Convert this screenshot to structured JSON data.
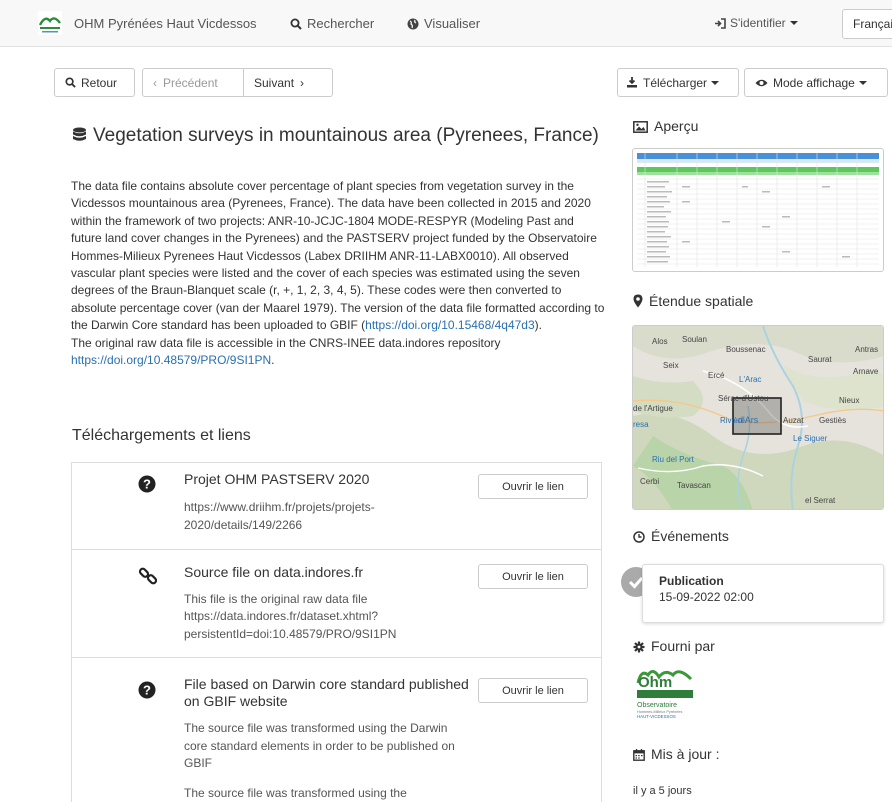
{
  "navbar": {
    "brand": "OHM Pyrénées Haut Vicdessos",
    "search": "Rechercher",
    "visualize": "Visualiser",
    "login": "S'identifier",
    "language": "Françai"
  },
  "toolbar": {
    "back": "Retour",
    "previous": "Précédent",
    "next": "Suivant",
    "download": "Télécharger",
    "display_mode": "Mode affichage"
  },
  "dataset": {
    "title": "Vegetation surveys in mountainous area (Pyrenees, France)",
    "description": "The data file contains absolute cover percentage of plant species from vegetation survey in the Vicdessos mountainous area (Pyrenees, France). The data have been collected in 2015 and 2020 within the framework of two projects: ANR-10-JCJC-1804 MODE-RESPYR (Modeling Past and future land cover changes in the Pyrenees) and the PASTSERV project funded by the Observatoire Hommes-Milieux Pyrenees Haut Vicdessos (Labex DRIIHM ANR-11-LABX0010). All observed vascular plant species were listed and the cover of each species was estimated using the seven degrees of the Braun-Blanquet scale (r, +, 1, 2, 3, 4, 5). These codes were then converted to absolute percentage cover (van der Maarel 1979). The version of the data file formatted according to the Darwin Core standard has been uploaded to GBIF (",
    "gbif_link": "https://doi.org/10.15468/4q47d3",
    "description_end": ").",
    "raw_text": "The original raw data file is accessible in the CNRS-INEE data.indores repository",
    "raw_link": "https://doi.org/10.48579/PRO/9SI1PN",
    "raw_end": "."
  },
  "downloads": {
    "heading": "Téléchargements et liens",
    "open_label": "Ouvrir le lien",
    "items": [
      {
        "title": "Projet OHM PASTSERV 2020",
        "text": "",
        "url": "https://www.driihm.fr/projets/projets-2020/details/149/2266",
        "icon": "question-circle-icon"
      },
      {
        "title": "Source file on data.indores.fr",
        "text": "This file is the original raw data file",
        "url": "https://data.indores.fr/dataset.xhtml?persistentId=doi:10.48579/PRO/9SI1PN",
        "icon": "link-icon"
      },
      {
        "title": "File based on Darwin core standard published on GBIF website",
        "text": "The source file was transformed using the Darwin core standard elements in order to be published on GBIF",
        "text2": "The source file was transformed using the",
        "url": "",
        "icon": "question-circle-icon"
      }
    ]
  },
  "sidebar": {
    "preview": "Aperçu",
    "extent": "Étendue spatiale",
    "events": "Événements",
    "event_title": "Publication",
    "event_date": "15-09-2022 02:00",
    "provided_by": "Fourni par",
    "updated_label": "Mis à jour :",
    "updated_value": "il y a 5 jours"
  },
  "map_labels": {
    "alos": "Alos",
    "soulan": "Soulan",
    "boussenac": "Boussenac",
    "antras": "Antras",
    "seix": "Seix",
    "saurat": "Saurat",
    "arnave": "Arnave",
    "erce": "Ercé",
    "larac": "L'Arac",
    "nieux": "Nieux",
    "serac": "Sérac-d'Ustou",
    "artigue": "de l'Artigue",
    "riviere": "Rivière",
    "dars": "d'Ars",
    "auzat": "Auzat",
    "gesties": "Gestiès",
    "resa": "resa",
    "siguer": "Le Siguer",
    "riudelport": "Riu del Port",
    "cerbi": "Cerbi",
    "tavascan": "Tavascan",
    "elserrat": "el Serrat"
  },
  "logo_text": {
    "ohm": "Ohm",
    "observatoire": "Observatoire",
    "subtitle": "Hommes-Milieux Pyrénées",
    "haut": "HAUT-VICDESSOS"
  },
  "colors": {
    "link": "#2a6fb0",
    "brand_green": "#3a9a3a",
    "map_water": "#aad3df",
    "map_green": "#c8dcaa"
  }
}
